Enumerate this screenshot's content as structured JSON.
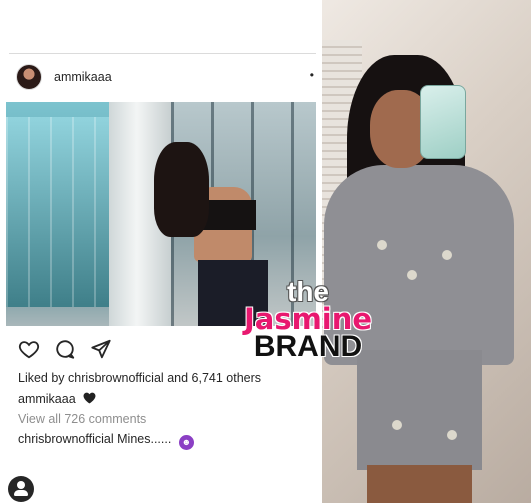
{
  "post": {
    "username": "ammikaaa",
    "more_icon": "ellipsis-icon",
    "likes_prefix": "Liked by",
    "likes_user": "chrisbrownofficial",
    "likes_suffix": "and 6,741 others",
    "caption_user": "ammikaaa",
    "caption_emoji": "black-heart",
    "view_all_comments": "View all 726 comments",
    "comment_user": "chrisbrownofficial",
    "comment_text": "Mines......",
    "comment_emoji": "smiling-devil"
  },
  "actions": {
    "like_icon": "heart-icon",
    "comment_icon": "comment-bubble-icon",
    "share_icon": "paper-plane-icon"
  },
  "watermark": {
    "line1": "the",
    "line2": "Jasmine",
    "line3": "BRAND",
    "colors": {
      "accent": "#e8186f",
      "dark": "#111111"
    }
  },
  "bottom_icon": "profile-icon"
}
